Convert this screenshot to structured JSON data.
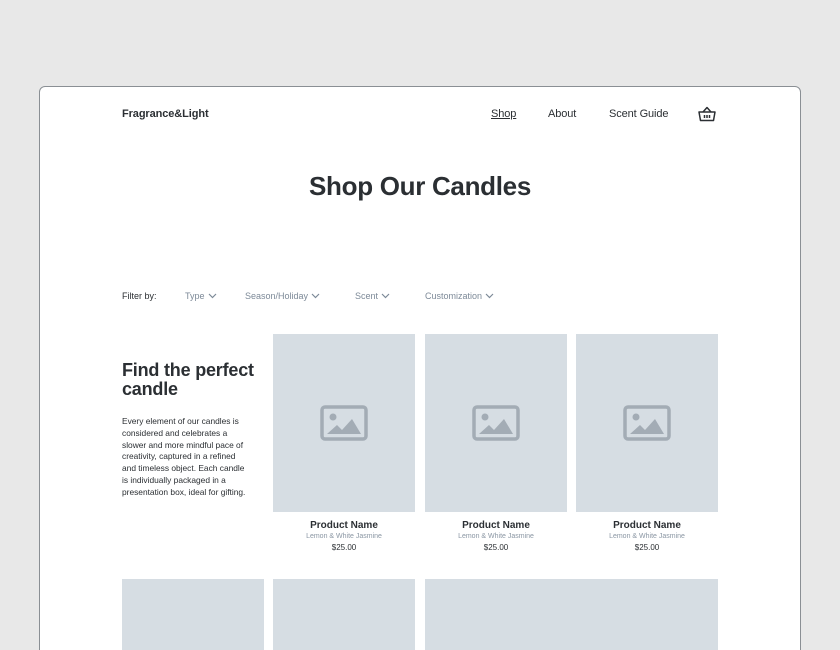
{
  "header": {
    "brand": "Fragrance&Light",
    "nav": [
      "Shop",
      "About",
      "Scent Guide"
    ],
    "cart_icon": "basket-icon"
  },
  "page": {
    "title": "Shop Our Candles"
  },
  "filters": {
    "label": "Filter by:",
    "options": [
      "Type",
      "Season/Holiday",
      "Scent",
      "Customization"
    ]
  },
  "intro": {
    "heading": "Find the perfect candle",
    "body": "Every element of our candles is considered and celebrates a slower and more mindful pace of creativity, captured in a refined and timeless object. Each candle is individually packaged in a presentation box, ideal for gifting."
  },
  "products": [
    {
      "name": "Product Name",
      "scent": "Lemon & White Jasmine",
      "price": "$25.00"
    },
    {
      "name": "Product Name",
      "scent": "Lemon & White Jasmine",
      "price": "$25.00"
    },
    {
      "name": "Product Name",
      "scent": "Lemon & White Jasmine",
      "price": "$25.00"
    }
  ],
  "colors": {
    "background": "#e8e8e8",
    "placeholder": "#d6dde3",
    "text": "#2b2f33",
    "muted": "#7d8a98"
  }
}
